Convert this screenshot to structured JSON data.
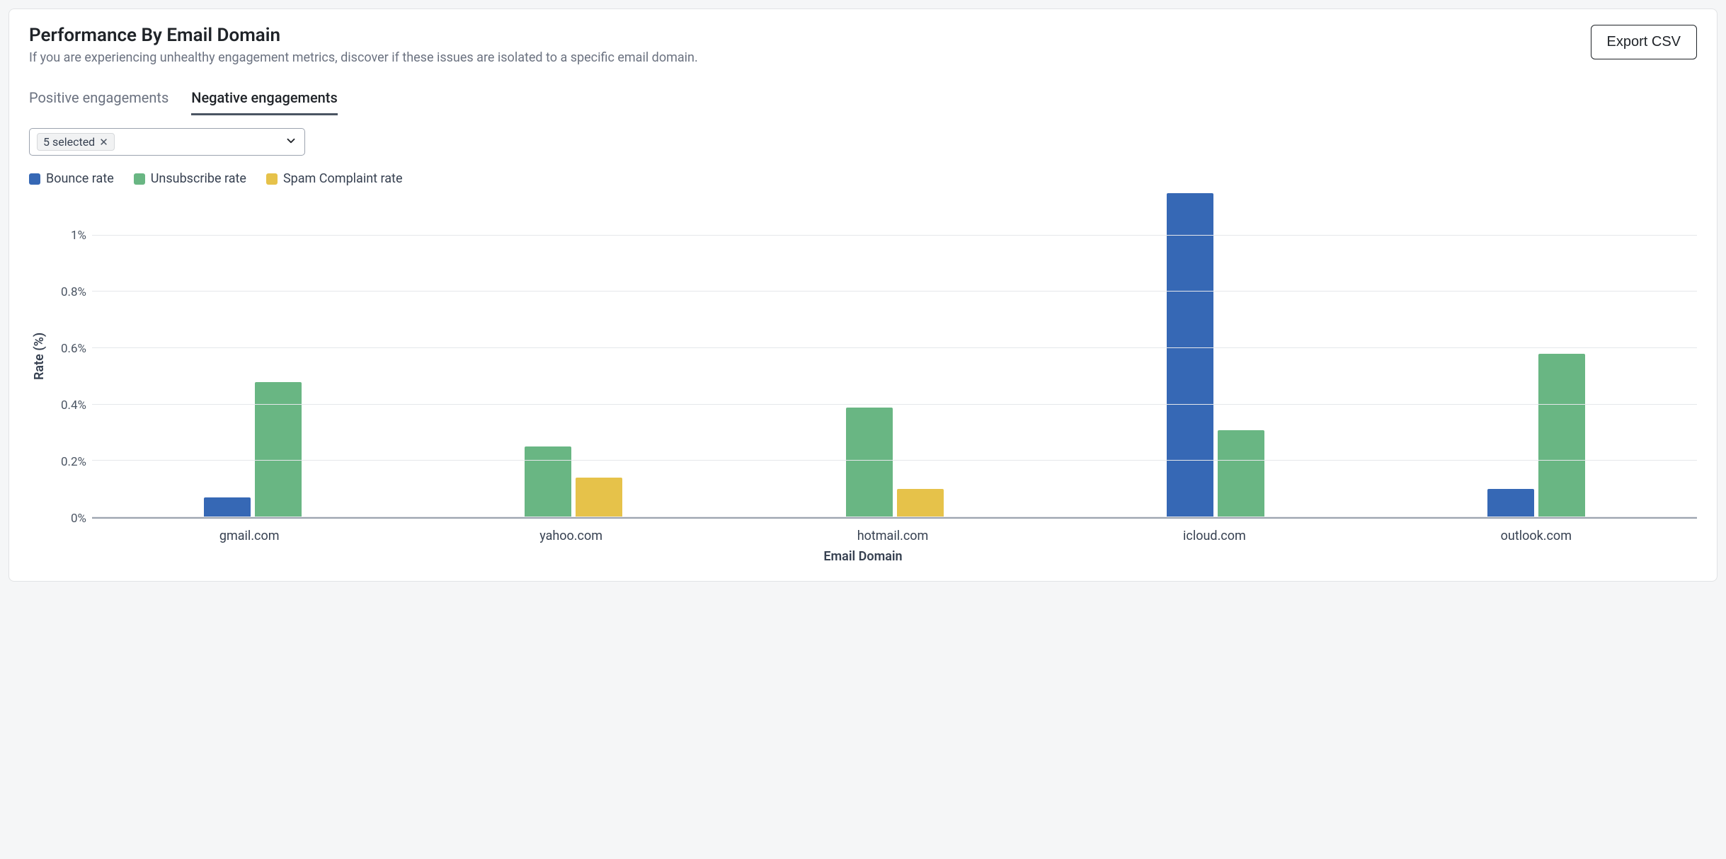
{
  "header": {
    "title": "Performance By Email Domain",
    "subtitle": "If you are experiencing unhealthy engagement metrics, discover if these issues are isolated to a specific email domain.",
    "export_label": "Export CSV"
  },
  "tabs": {
    "positive": "Positive engagements",
    "negative": "Negative engagements",
    "active": "negative"
  },
  "filter": {
    "chip_label": "5 selected"
  },
  "legend": {
    "bounce": "Bounce rate",
    "unsubscribe": "Unsubscribe rate",
    "spam": "Spam Complaint rate"
  },
  "colors": {
    "bounce": "#3668b5",
    "unsubscribe": "#69b683",
    "spam": "#e6c24a"
  },
  "axes": {
    "xlabel": "Email Domain",
    "ylabel": "Rate (%)"
  },
  "chart_data": {
    "type": "bar",
    "title": "Performance By Email Domain — Negative engagements",
    "xlabel": "Email Domain",
    "ylabel": "Rate (%)",
    "ylim": [
      0,
      1.15
    ],
    "yticks": [
      0,
      0.2,
      0.4,
      0.6,
      0.8,
      1
    ],
    "ytick_labels": [
      "0%",
      "0.2%",
      "0.4%",
      "0.6%",
      "0.8%",
      "1%"
    ],
    "categories": [
      "gmail.com",
      "yahoo.com",
      "hotmail.com",
      "icloud.com",
      "outlook.com"
    ],
    "series": [
      {
        "name": "Bounce rate",
        "color": "#3668b5",
        "values": [
          0.07,
          0.0,
          0.0,
          1.15,
          0.1
        ]
      },
      {
        "name": "Unsubscribe rate",
        "color": "#69b683",
        "values": [
          0.48,
          0.25,
          0.39,
          0.31,
          0.58
        ]
      },
      {
        "name": "Spam Complaint rate",
        "color": "#e6c24a",
        "values": [
          0.0,
          0.14,
          0.1,
          0.0,
          0.0
        ]
      }
    ]
  }
}
